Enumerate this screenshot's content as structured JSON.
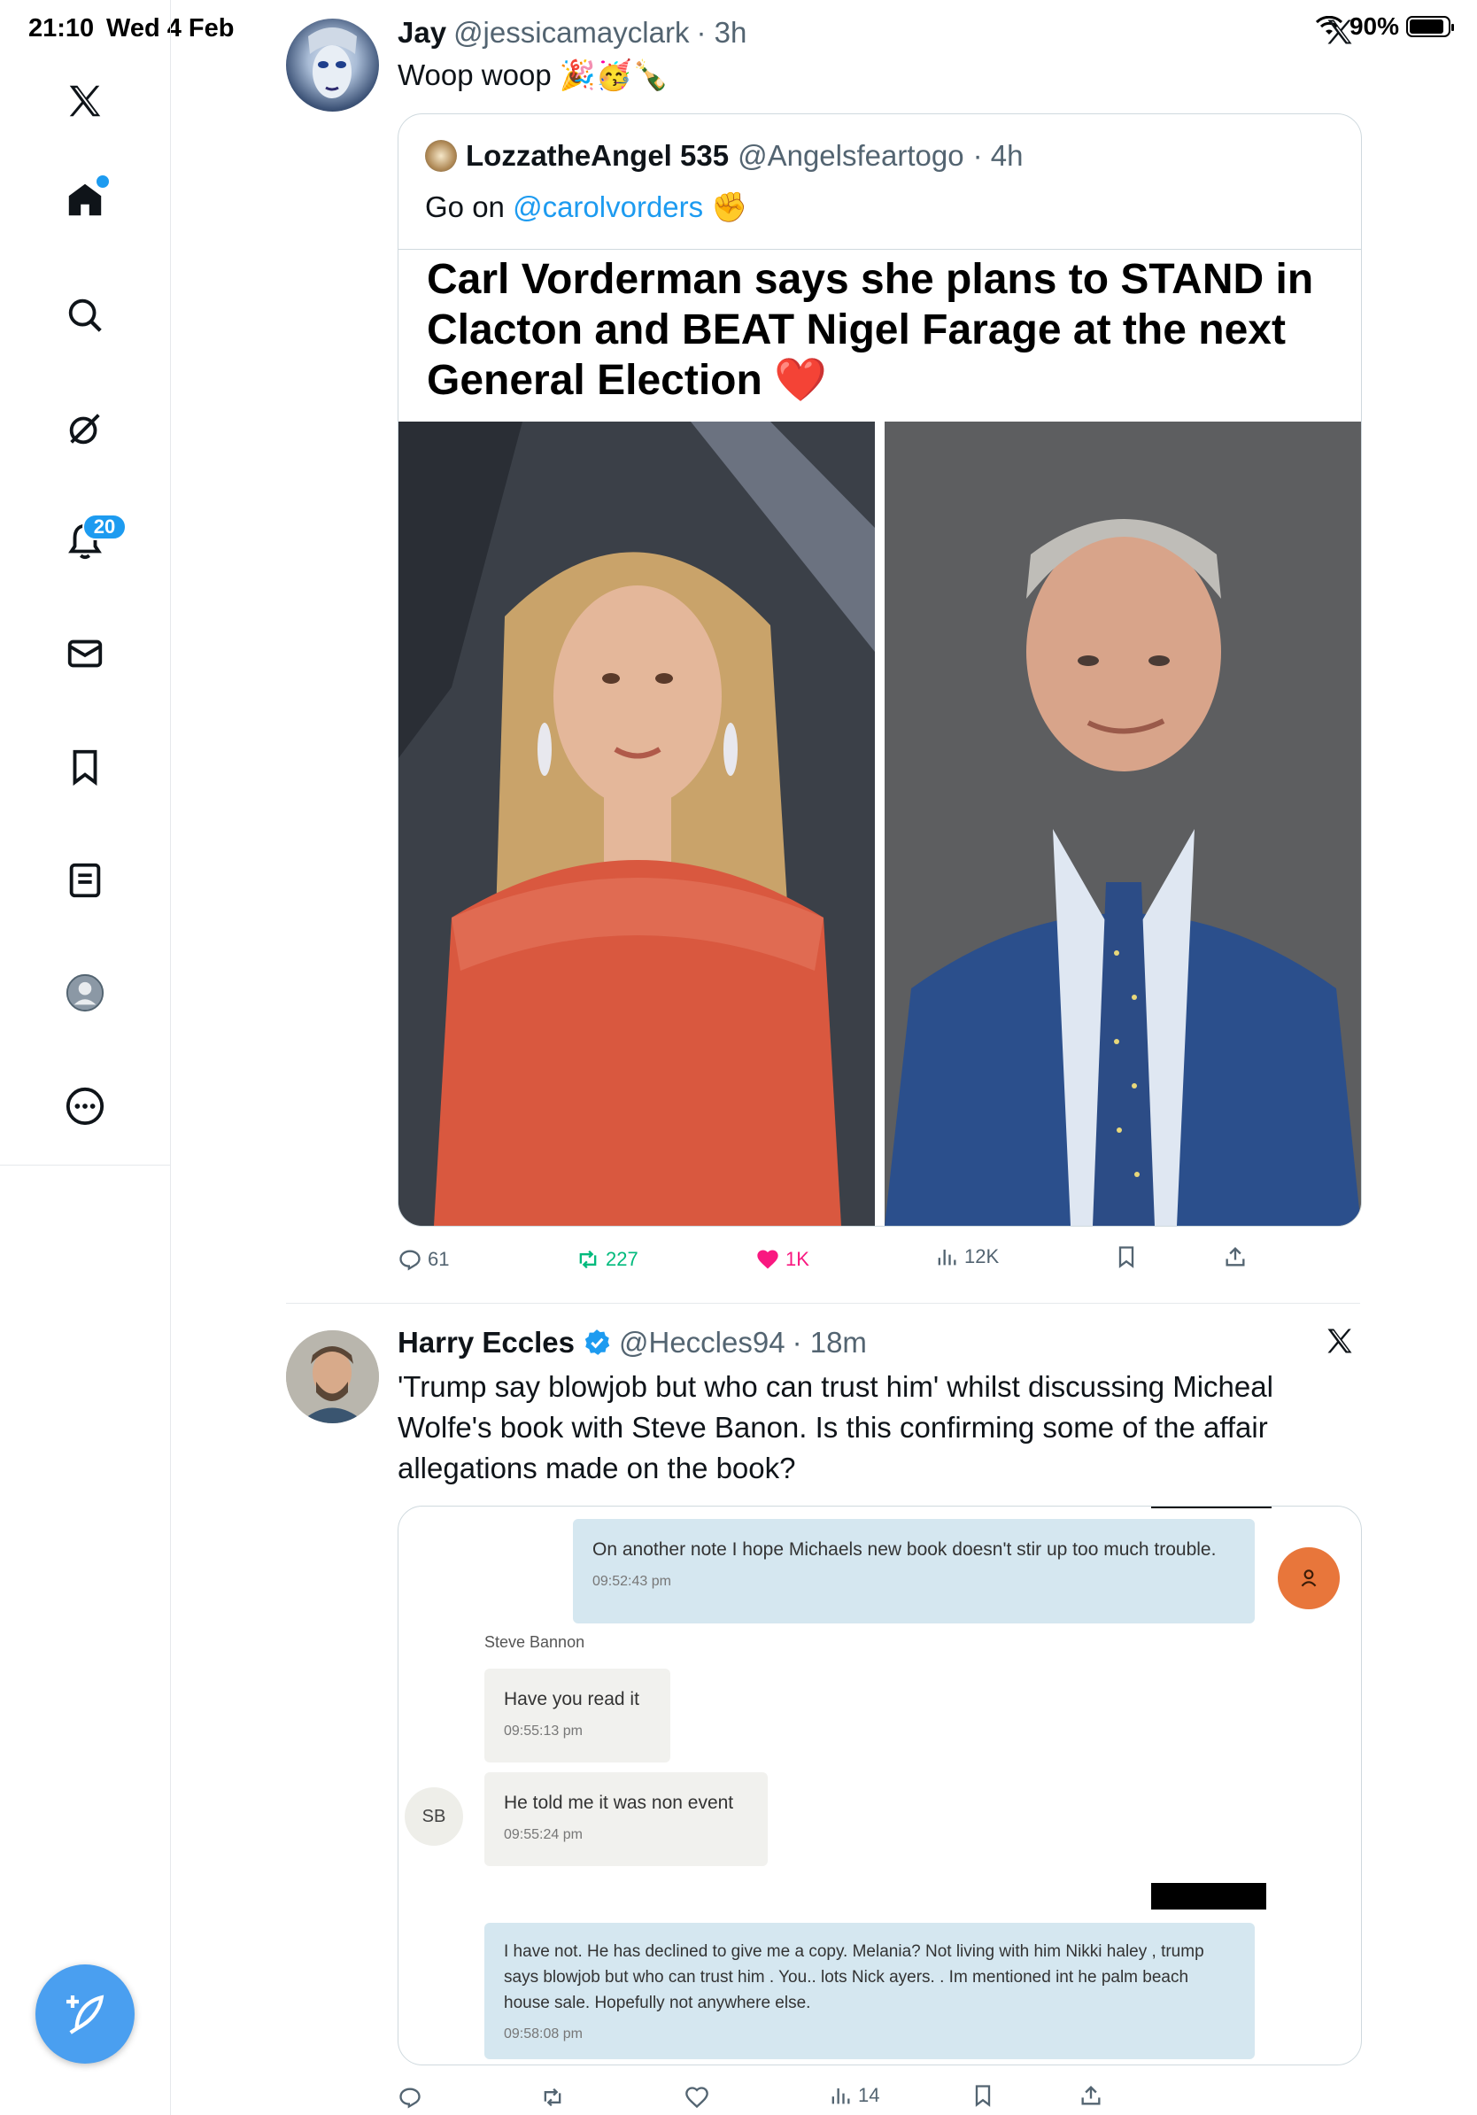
{
  "status": {
    "time": "21:10",
    "date": "Wed 4 Feb",
    "battery": "90%"
  },
  "sidebar": {
    "items": [
      {
        "name": "x-logo-icon"
      },
      {
        "name": "home-icon"
      },
      {
        "name": "search-icon"
      },
      {
        "name": "grok-icon"
      },
      {
        "name": "notifications-icon"
      },
      {
        "name": "messages-icon"
      },
      {
        "name": "bookmarks-icon"
      },
      {
        "name": "lists-icon"
      },
      {
        "name": "profile-icon"
      },
      {
        "name": "more-icon"
      }
    ],
    "notification_count": "20",
    "compose_icon": "compose-icon"
  },
  "tweet1": {
    "name": "Jay",
    "handle": "@jessicamayclark",
    "time": "· 3h",
    "text": "Woop woop 🎉🥳🍾",
    "quote": {
      "name": "LozzatheAngel 535",
      "handle": "@Angelsfeartogo",
      "time": "· 4h",
      "text_prefix": "Go on ",
      "mention": "@carolvorders",
      "text_suffix": " ✊",
      "headline": "Carl Vorderman says she plans to STAND in Clacton and BEAT Nigel Farage at the next General Election ❤️"
    },
    "actions": {
      "replies": "61",
      "reposts": "227",
      "likes": "1K",
      "views": "12K"
    }
  },
  "tweet2": {
    "name": "Harry Eccles",
    "handle": "@Heccles94",
    "time": "· 18m",
    "text": "'Trump say blowjob but who can trust him' whilst discussing Micheal Wolfe's book with Steve Banon. Is this confirming some of the affair allegations made on the book?",
    "chat": {
      "msg1": "On another note I hope Michaels new book doesn't stir up too much trouble.",
      "msg1_time": "09:52:43 pm",
      "sender": "Steve Bannon",
      "msg2": "Have you read it",
      "msg2_time": "09:55:13 pm",
      "msg3": "He told me it was non event",
      "msg3_time": "09:55:24 pm",
      "initials": "SB",
      "msg4": "I have not.   He has declined to give me a copy.    Melania? Not living with him  Nikki haley , trump says blowjob but who can trust him . You..  lots   Nick ayers. .   Im mentioned int he palm beach house sale.   Hopefully not anywhere else.",
      "msg4_time": "09:58:08 pm"
    },
    "actions": {
      "views": "14"
    }
  },
  "colors": {
    "accent": "#1d9bf0",
    "like": "#f91880",
    "repost": "#00ba7c"
  }
}
